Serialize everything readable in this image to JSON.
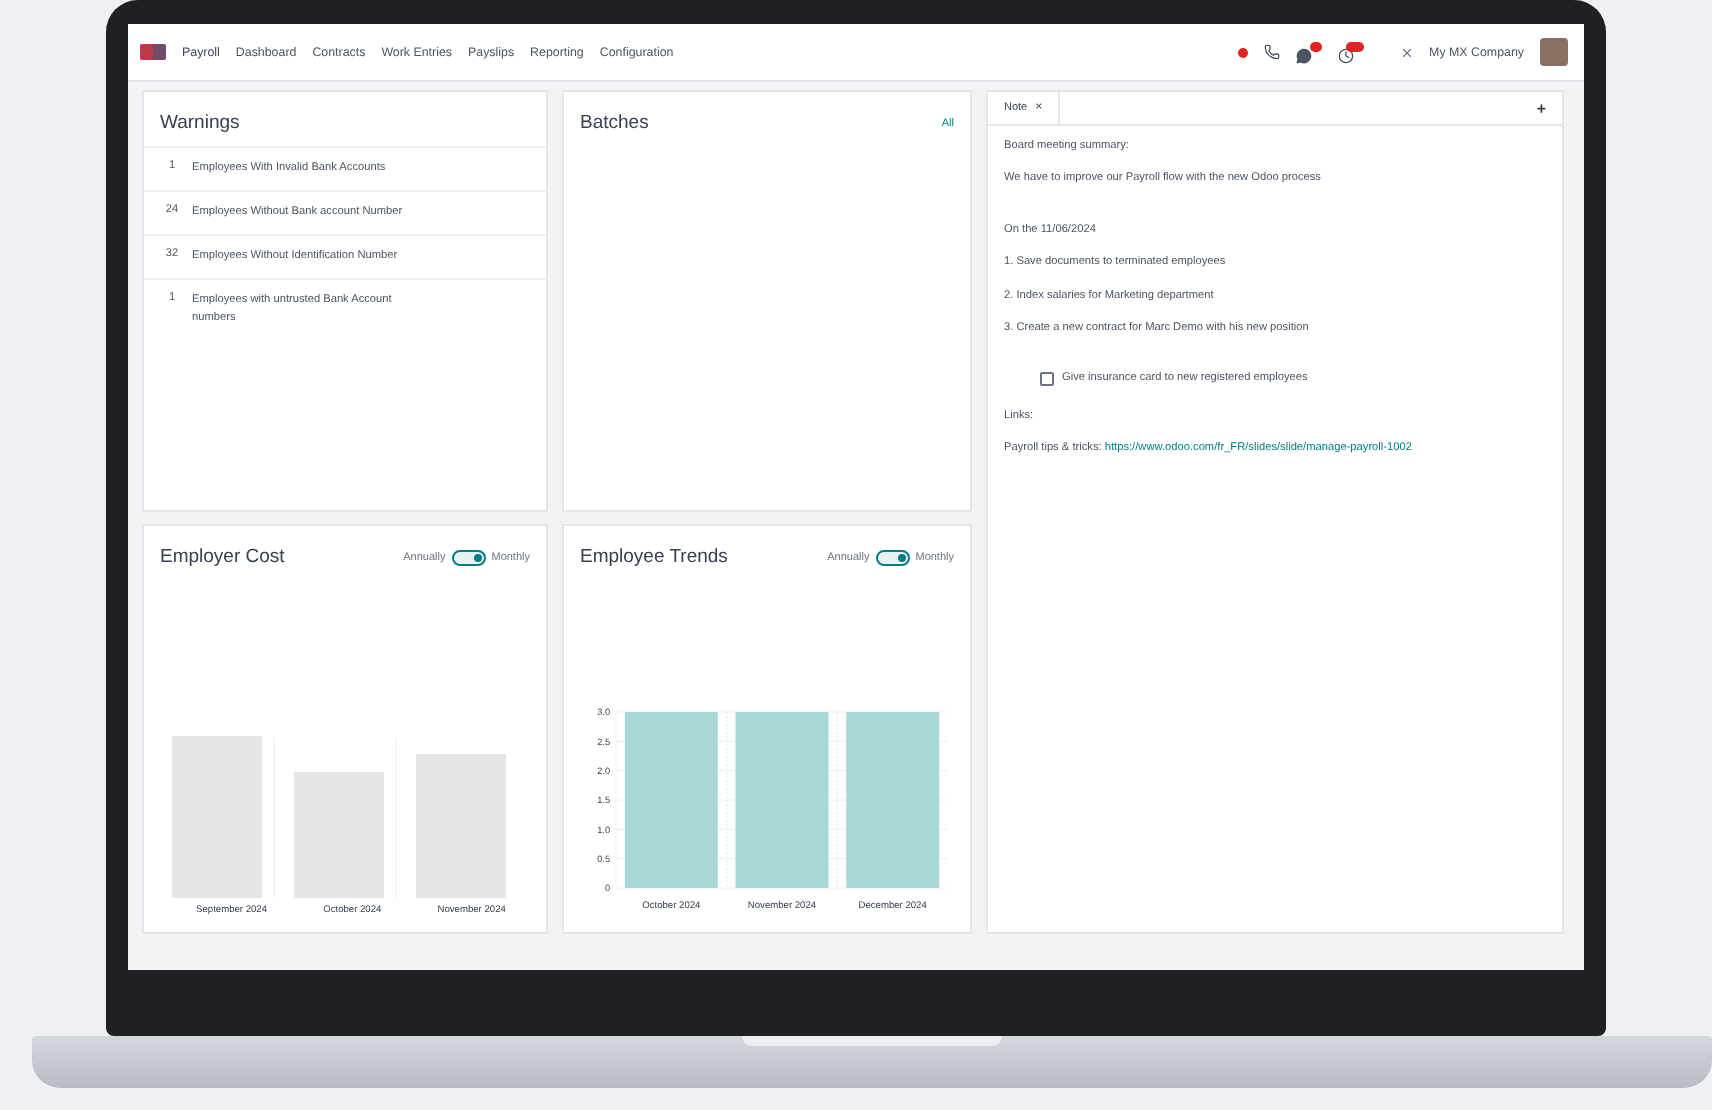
{
  "navbar": {
    "app": "Payroll",
    "menu": [
      "Dashboard",
      "Contracts",
      "Work Entries",
      "Payslips",
      "Reporting",
      "Configuration"
    ],
    "company": "My MX Company"
  },
  "warnings": {
    "title": "Warnings",
    "rows": [
      {
        "count": "1",
        "label": "Employees With Invalid Bank Accounts"
      },
      {
        "count": "24",
        "label": "Employees Without Bank account Number"
      },
      {
        "count": "32",
        "label": "Employees Without Identification Number"
      },
      {
        "count": "1",
        "label": "Employees with untrusted Bank Account numbers"
      }
    ]
  },
  "batches": {
    "title": "Batches",
    "link": "All"
  },
  "employer_cost": {
    "title": "Employer Cost",
    "toggle": {
      "left": "Annually",
      "right": "Monthly",
      "on": true
    },
    "x_labels": [
      "September 2024",
      "October 2024",
      "November 2024"
    ]
  },
  "employee_trends": {
    "title": "Employee Trends",
    "toggle": {
      "left": "Annually",
      "right": "Monthly",
      "on": true
    },
    "chart_data": {
      "type": "bar",
      "grid": true,
      "categories": [
        "October 2024",
        "November 2024",
        "December 2024"
      ],
      "values": [
        3,
        3,
        3
      ],
      "ylim": [
        0,
        3
      ],
      "yticks": [
        0,
        0.5,
        {
          "value": 1,
          "label": "1.0"
        },
        {
          "value": 1.5,
          "label": "1.5"
        },
        {
          "value": 2,
          "label": "2.0"
        },
        {
          "value": 2.5,
          "label": "2.5"
        },
        {
          "value": 3,
          "label": "3.0"
        }
      ]
    }
  },
  "note": {
    "tab": "Note",
    "close": "×",
    "add": "+",
    "sections": [
      {
        "lines": [
          {
            "kind": "text",
            "text": "Board meeting summary:"
          },
          {
            "kind": "text",
            "text": "We have to improve our Payroll flow with the new Odoo process"
          }
        ]
      },
      {
        "lines": [
          {
            "kind": "text",
            "text": "On the 11/06/2024"
          },
          {
            "kind": "text",
            "text": "1. Save documents to terminated employees"
          },
          {
            "kind": "text",
            "text": "2. Index salaries for Marketing department"
          },
          {
            "kind": "text",
            "text": "3. Create a new contract for Marc Demo with his new position"
          }
        ]
      },
      {
        "lines": [
          {
            "kind": "checkbox",
            "text": "Give insurance card to new registered employees",
            "checked": false
          },
          {
            "kind": "text",
            "text": "Links:"
          },
          {
            "kind": "link",
            "text": "Payroll tips & tricks:",
            "url": "https://www.odoo.com/fr_FR/slides/slide/manage-payroll-1002"
          }
        ]
      }
    ]
  }
}
